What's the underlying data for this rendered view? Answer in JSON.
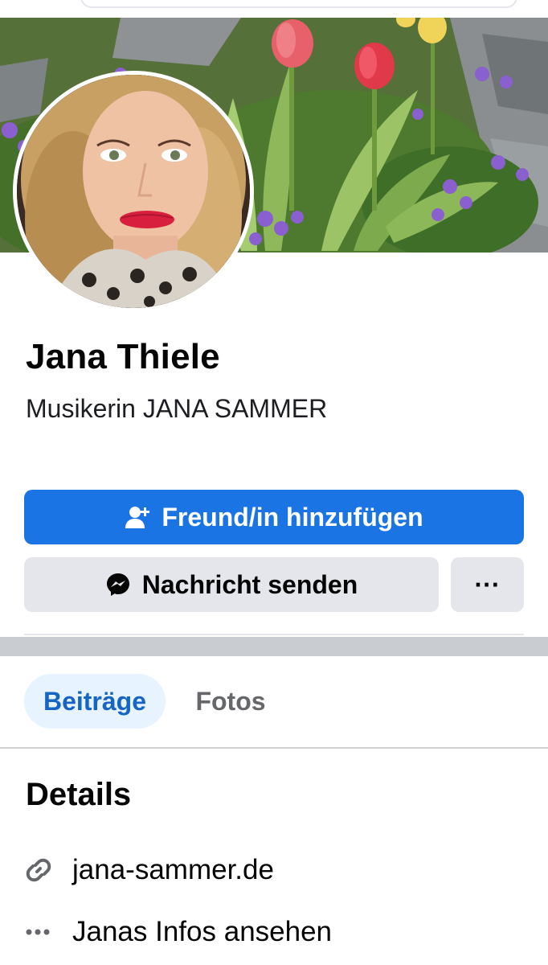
{
  "profile": {
    "name": "Jana Thiele",
    "bio": "Musikerin JANA SAMMER"
  },
  "actions": {
    "add_friend_label": "Freund/in hinzufügen",
    "add_friend_icon": "add-person-icon",
    "message_label": "Nachricht senden",
    "message_icon": "messenger-icon",
    "more_label": "···",
    "more_icon": "more-dots-icon"
  },
  "tabs": [
    {
      "label": "Beiträge",
      "active": true
    },
    {
      "label": "Fotos",
      "active": false
    }
  ],
  "details": {
    "title": "Details",
    "items": [
      {
        "icon": "link-icon",
        "text": "jana-sammer.de"
      },
      {
        "icon": "more-dots-icon",
        "text": "Janas Infos ansehen"
      }
    ]
  },
  "colors": {
    "primary_button": "#1b74e4",
    "secondary_button": "#e4e6eb",
    "active_tab_bg": "#e7f3ff",
    "active_tab_text": "#1664c4",
    "inactive_tab_text": "#65676b",
    "section_divider": "#c9ccd1"
  }
}
